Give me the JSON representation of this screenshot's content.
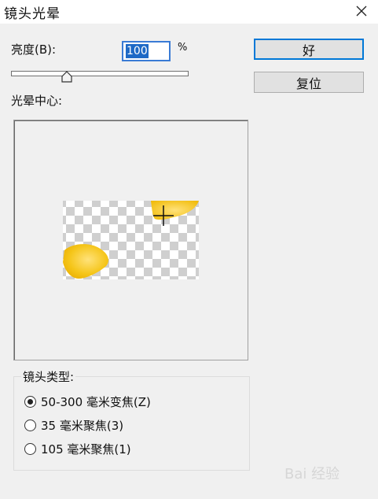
{
  "window": {
    "title": "镜头光晕"
  },
  "brightness": {
    "label": "亮度(B):",
    "value": "100",
    "unit": "%",
    "slider_level_percent": 33
  },
  "buttons": {
    "ok": "好",
    "reset": "复位"
  },
  "flare_center": {
    "label": "光晕中心:"
  },
  "lens_type": {
    "label": "镜头类型:",
    "options": [
      {
        "label": "50-300 毫米变焦(Z)",
        "checked": true
      },
      {
        "label": "35 毫米聚焦(3)",
        "checked": false
      },
      {
        "label": "105 毫米聚焦(1)",
        "checked": false
      }
    ]
  },
  "watermark": {
    "text": "Bai 经验"
  }
}
